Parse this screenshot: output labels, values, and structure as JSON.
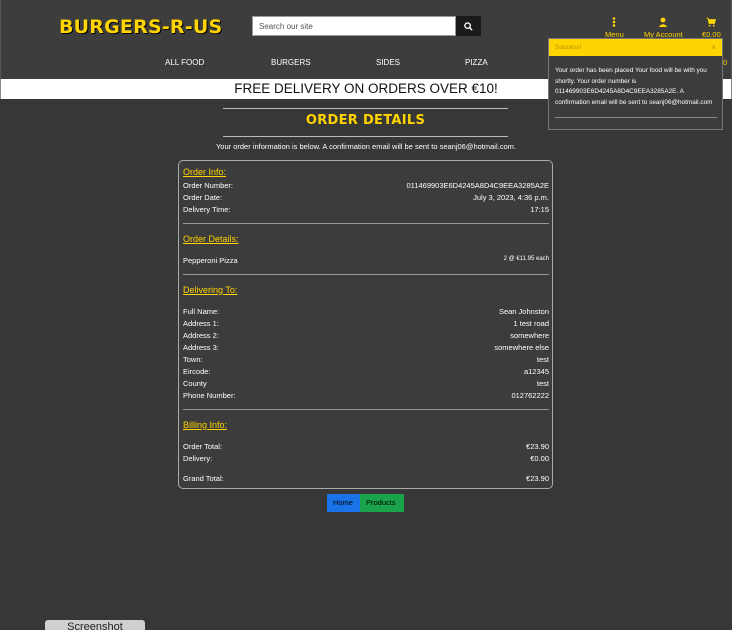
{
  "header": {
    "logo": "BURGERS-R-US",
    "search_placeholder": "Search our site",
    "menu_label": "Menu",
    "account_label": "My Account",
    "bag_total": "€0.00",
    "bag_total_behind": "0"
  },
  "nav": [
    "ALL FOOD",
    "BURGERS",
    "SIDES",
    "PIZZA"
  ],
  "banner": "FREE DELIVERY ON ORDERS OVER €10!",
  "page": {
    "title": "ORDER DETAILS",
    "intro_prefix": "Your order information is below. A confirmation email will be sent to ",
    "intro_email": "seanj06@hotmail.com",
    "intro_suffix": "."
  },
  "order_info": {
    "title": "Order Info:",
    "rows": [
      {
        "label": "Order Number:",
        "value": "011469903E6D4245A8D4C9EEA3285A2E"
      },
      {
        "label": "Order Date:",
        "value": "July 3, 2023, 4:36 p.m."
      },
      {
        "label": "Delivery Time:",
        "value": "17:15"
      }
    ]
  },
  "order_details": {
    "title": "Order Details:",
    "item_name": "Pepperoni Pizza",
    "item_qty": "2 @ €11.95 each"
  },
  "delivering_to": {
    "title": "Delivering To:",
    "rows": [
      {
        "label": "Full Name:",
        "value": "Sean Johnston"
      },
      {
        "label": "Address 1:",
        "value": "1 test road"
      },
      {
        "label": "Address 2:",
        "value": "somewhere"
      },
      {
        "label": "Address 3:",
        "value": "somewhere else"
      },
      {
        "label": "Town:",
        "value": "test"
      },
      {
        "label": "Eircode:",
        "value": "a12345"
      },
      {
        "label": "County",
        "value": "test"
      },
      {
        "label": "Phone Number:",
        "value": "012762222"
      }
    ]
  },
  "billing_info": {
    "title": "Billing Info:",
    "order_total_label": "Order Total:",
    "order_total": "€23.90",
    "delivery_label": "Delivery:",
    "delivery": "€0.00",
    "grand_total_label": "Grand Total:",
    "grand_total": "€23.90"
  },
  "buttons": {
    "home": "Home",
    "products": "Products"
  },
  "toast": {
    "title": "Success!",
    "close": "×",
    "message": "Your order has been placed Your food will be with you shortly. Your order number is 011469903E6D4245A8D4C9EEA3285A2E. A confirmation email will be sent to seanj06@hotmail.com"
  },
  "screenshot_tab": "Screenshot",
  "colors": {
    "accent": "#ffd400",
    "background": "#373737",
    "home_button": "#1a73e8",
    "products_button": "#1aa34a"
  }
}
